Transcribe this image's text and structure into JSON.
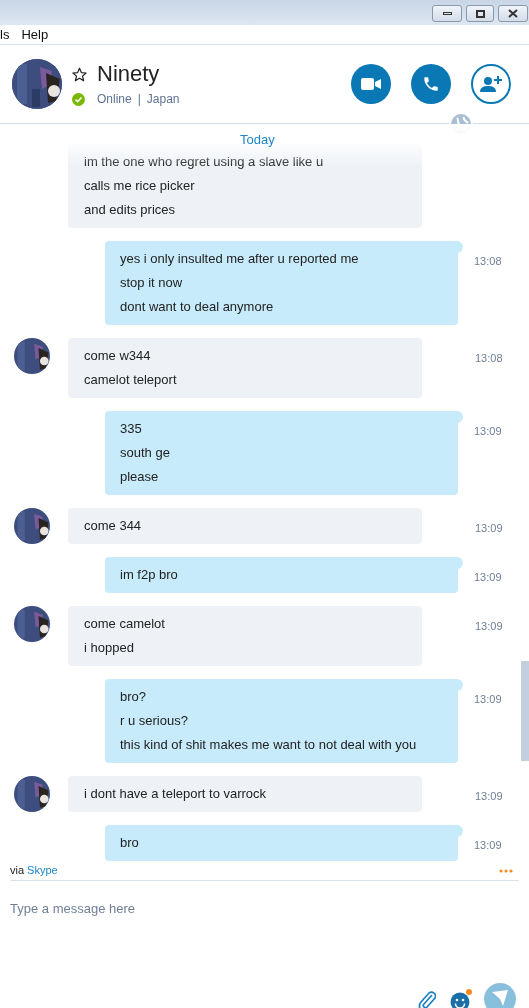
{
  "menu": [
    "ls",
    "Help"
  ],
  "contact": {
    "name": "Ninety",
    "status": "Online",
    "separator": "|",
    "location": "Japan",
    "favorite": false,
    "online": true
  },
  "date_divider": "Today",
  "messages": [
    {
      "kind": "incoming",
      "avatar": false,
      "lines": [
        "im the one who regret using a slave like u",
        "calls me rice picker",
        "and edits prices"
      ]
    },
    {
      "kind": "outgoing",
      "lines": [
        "yes i only insulted me after u reported me",
        "stop it now",
        "dont want to deal anymore"
      ],
      "time": "13:08"
    },
    {
      "kind": "incoming",
      "avatar": true,
      "lines": [
        "come w344",
        "camelot teleport"
      ],
      "time": "13:08"
    },
    {
      "kind": "outgoing",
      "lines": [
        "335",
        "south ge",
        "please"
      ],
      "time": "13:09"
    },
    {
      "kind": "incoming",
      "avatar": true,
      "lines": [
        "come 344"
      ],
      "time": "13:09"
    },
    {
      "kind": "outgoing",
      "lines": [
        "im f2p bro"
      ],
      "time": "13:09"
    },
    {
      "kind": "incoming",
      "avatar": true,
      "lines": [
        "come camelot",
        "i hopped"
      ],
      "time": "13:09"
    },
    {
      "kind": "outgoing",
      "lines": [
        "bro?",
        "r u serious?",
        "this kind of shit makes me want to not deal with you"
      ],
      "time": "13:09"
    },
    {
      "kind": "incoming",
      "avatar": true,
      "lines": [
        "i dont have a teleport to varrock"
      ],
      "time": "13:09"
    },
    {
      "kind": "outgoing",
      "lines": [
        "bro"
      ],
      "time": "13:09"
    }
  ],
  "composer": {
    "via": "via",
    "service": "Skype",
    "placeholder": "Type a message here"
  }
}
